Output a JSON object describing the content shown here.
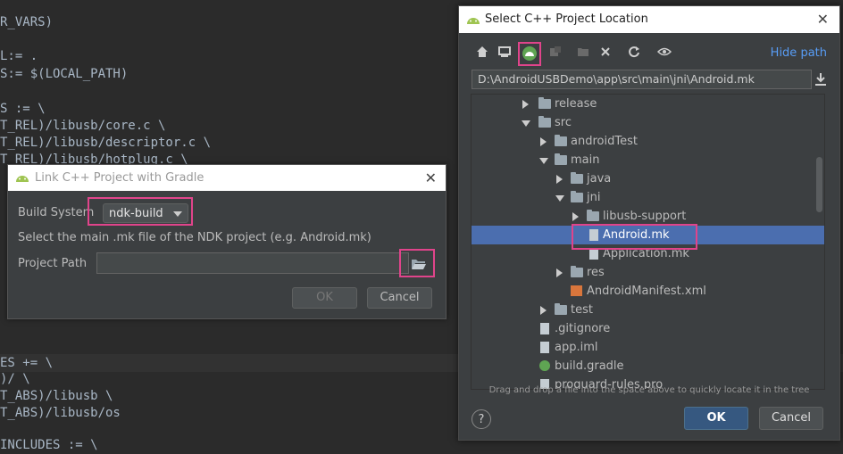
{
  "editor": {
    "lines": [
      {
        "text": "R_VARS)"
      },
      {
        "text": "L:= ."
      },
      {
        "text": "S:= $(LOCAL_PATH)"
      },
      {
        "text": "S := \\"
      },
      {
        "text": "T_REL)/libusb/core.c \\"
      },
      {
        "text": "T_REL)/libusb/descriptor.c \\"
      },
      {
        "text": "T_REL)/libusb/hotplug.c \\"
      },
      {
        "text": "ES += \\"
      },
      {
        "text": ")/ \\"
      },
      {
        "text": "T_ABS)/libusb \\"
      },
      {
        "text": "T_ABS)/libusb/os"
      },
      {
        "text": "INCLUDES := \\"
      }
    ]
  },
  "gradle_dialog": {
    "title": "Link C++ Project with Gradle",
    "build_system_label": "Build System",
    "build_system_value": "ndk-build",
    "instruction": "Select the main .mk file of the NDK project (e.g. Android.mk)",
    "project_path_label": "Project Path",
    "project_path_value": "",
    "ok_label": "OK",
    "cancel_label": "Cancel",
    "close_glyph": "✕"
  },
  "project_dialog": {
    "title": "Select C++ Project Location",
    "close_glyph": "✕",
    "hide_path_label": "Hide path",
    "path_value": "D:\\AndroidUSBDemo\\app\\src\\main\\jni\\Android.mk",
    "toolbar_icons": [
      "home-icon",
      "desktop-icon",
      "android-project-icon",
      "module-icon",
      "new-folder-icon",
      "delete-icon",
      "refresh-icon",
      "show-hidden-icon"
    ],
    "tree": [
      {
        "label": "release",
        "kind": "folder",
        "toggle": "collapsed"
      },
      {
        "label": "src",
        "kind": "folder",
        "toggle": "expanded"
      },
      {
        "label": "androidTest",
        "kind": "folder",
        "toggle": "collapsed"
      },
      {
        "label": "main",
        "kind": "folder",
        "toggle": "expanded"
      },
      {
        "label": "java",
        "kind": "folder",
        "toggle": "collapsed"
      },
      {
        "label": "jni",
        "kind": "folder",
        "toggle": "expanded"
      },
      {
        "label": "libusb-support",
        "kind": "folder",
        "toggle": "collapsed"
      },
      {
        "label": "Android.mk",
        "kind": "file",
        "selected": true
      },
      {
        "label": "Application.mk",
        "kind": "file"
      },
      {
        "label": "res",
        "kind": "folder",
        "toggle": "collapsed"
      },
      {
        "label": "AndroidManifest.xml",
        "kind": "xml"
      },
      {
        "label": "test",
        "kind": "folder",
        "toggle": "collapsed"
      },
      {
        "label": ".gitignore",
        "kind": "file"
      },
      {
        "label": "app.iml",
        "kind": "file"
      },
      {
        "label": "build.gradle",
        "kind": "gradle"
      },
      {
        "label": "proguard-rules.pro",
        "kind": "file"
      }
    ],
    "hint": "Drag and drop a file into the space above to quickly locate it in the tree",
    "help_label": "?",
    "ok_label": "OK",
    "cancel_label": "Cancel"
  },
  "colors": {
    "highlight": "#e0448b",
    "selection": "#4b6eaf",
    "primary_button": "#365880",
    "link": "#589df6"
  }
}
